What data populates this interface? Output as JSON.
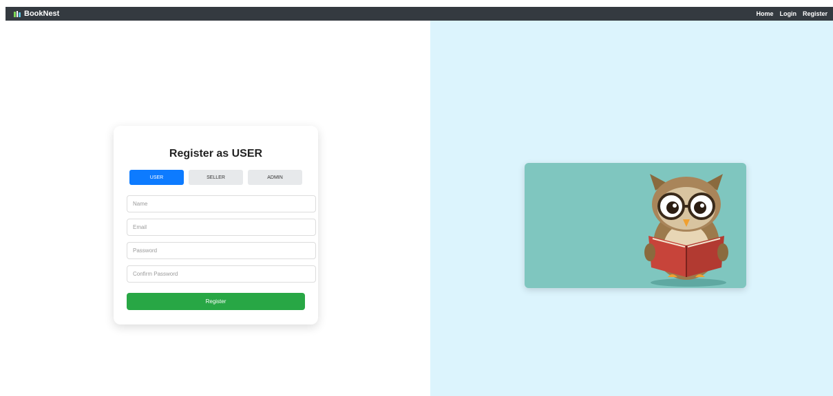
{
  "navbar": {
    "brand": "BookNest",
    "links": [
      "Home",
      "Login",
      "Register"
    ]
  },
  "register_form": {
    "title": "Register as USER",
    "roles": [
      "USER",
      "SELLER",
      "ADMIN"
    ],
    "active_role": "USER",
    "fields": {
      "name": {
        "placeholder": "Name",
        "value": ""
      },
      "email": {
        "placeholder": "Email",
        "value": ""
      },
      "password": {
        "placeholder": "Password",
        "value": ""
      },
      "confirm_password": {
        "placeholder": "Confirm Password",
        "value": ""
      }
    },
    "submit_label": "Register"
  },
  "illustration": {
    "icon": "owl-reading-book-icon"
  },
  "colors": {
    "navbar_bg": "#343a40",
    "active_tab": "#0d7bff",
    "submit_button": "#28a745",
    "right_panel_bg": "#dcf4fd",
    "illustration_bg": "#7fc6bf"
  }
}
